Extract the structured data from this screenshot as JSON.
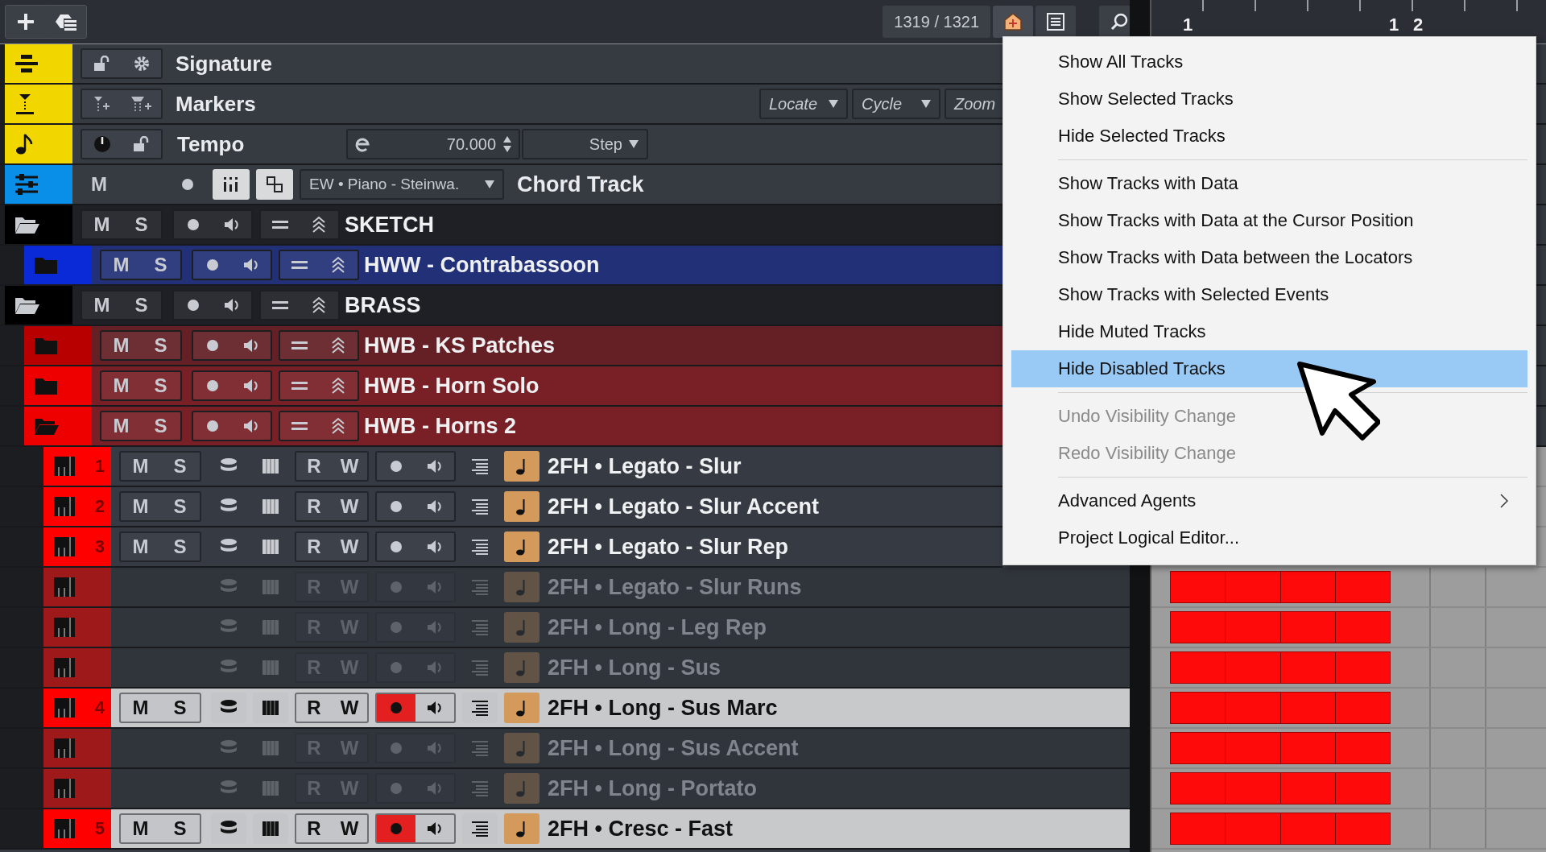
{
  "toolbar": {
    "counter": "1319 / 1321"
  },
  "ruler": {
    "labels": [
      "1",
      "1",
      "2"
    ]
  },
  "tracks": [
    {
      "kind": "signature",
      "name": "Signature",
      "color": "#f2d600"
    },
    {
      "kind": "markers",
      "name": "Markers",
      "color": "#f2d600",
      "dropdowns": [
        {
          "label": "Locate",
          "caret": true
        },
        {
          "label": "Cycle",
          "caret": true
        },
        {
          "label": "Zoom",
          "caret": false
        }
      ]
    },
    {
      "kind": "tempo",
      "name": "Tempo",
      "color": "#f2d600",
      "on": true,
      "value": "70.000",
      "mode": "Step"
    },
    {
      "kind": "chord",
      "name": "Chord Track",
      "color": "#0a8fe8",
      "mute": "M",
      "instrument": "EW • Piano - Steinwa.",
      "editor_on": true,
      "voicing_on": true
    },
    {
      "kind": "folder",
      "name": "SKETCH",
      "color": "#000000",
      "mute": "M",
      "solo": "S",
      "expanded": true,
      "children": [
        {
          "kind": "folder",
          "name": "HWW - Contrabassoon",
          "color": "#0a2ad8",
          "mute": "M",
          "solo": "S",
          "expanded": false
        }
      ]
    },
    {
      "kind": "folder",
      "name": "BRASS",
      "color": "#000000",
      "mute": "M",
      "solo": "S",
      "expanded": true,
      "children": [
        {
          "kind": "folder",
          "name": "HWB - KS Patches",
          "color": "#b80000",
          "mute": "M",
          "solo": "S",
          "expanded": false
        },
        {
          "kind": "folder",
          "name": "HWB - Horn Solo",
          "color": "#ee0000",
          "mute": "M",
          "solo": "S",
          "expanded": false
        },
        {
          "kind": "folder",
          "name": "HWB - Horns 2",
          "color": "#ee0000",
          "mute": "M",
          "solo": "S",
          "expanded": true,
          "children": [
            {
              "kind": "midi",
              "number": "1",
              "name": "2FH • Legato - Slur",
              "color": "#ff0000",
              "mute": "M",
              "solo": "S",
              "read": "R",
              "write": "W",
              "enabled": true,
              "selected": false,
              "record": false
            },
            {
              "kind": "midi",
              "number": "2",
              "name": "2FH • Legato - Slur Accent",
              "color": "#ff0000",
              "mute": "M",
              "solo": "S",
              "read": "R",
              "write": "W",
              "enabled": true,
              "selected": false,
              "record": false
            },
            {
              "kind": "midi",
              "number": "3",
              "name": "2FH • Legato - Slur Rep",
              "color": "#ff0000",
              "mute": "M",
              "solo": "S",
              "read": "R",
              "write": "W",
              "enabled": true,
              "selected": false,
              "record": false
            },
            {
              "kind": "midi",
              "name": "2FH • Legato - Slur Runs",
              "color": "#9e1a1a",
              "read": "R",
              "write": "W",
              "enabled": false,
              "selected": false,
              "record": false
            },
            {
              "kind": "midi",
              "name": "2FH • Long - Leg Rep",
              "color": "#9e1a1a",
              "read": "R",
              "write": "W",
              "enabled": false,
              "selected": false,
              "record": false
            },
            {
              "kind": "midi",
              "name": "2FH • Long - Sus",
              "color": "#9e1a1a",
              "read": "R",
              "write": "W",
              "enabled": false,
              "selected": false,
              "record": false
            },
            {
              "kind": "midi",
              "number": "4",
              "name": "2FH • Long - Sus Marc",
              "color": "#ff0000",
              "mute": "M",
              "solo": "S",
              "read": "R",
              "write": "W",
              "enabled": true,
              "selected": true,
              "record": true
            },
            {
              "kind": "midi",
              "name": "2FH • Long - Sus Accent",
              "color": "#9e1a1a",
              "read": "R",
              "write": "W",
              "enabled": false,
              "selected": false,
              "record": false
            },
            {
              "kind": "midi",
              "name": "2FH • Long - Portato",
              "color": "#9e1a1a",
              "read": "R",
              "write": "W",
              "enabled": false,
              "selected": false,
              "record": false
            },
            {
              "kind": "midi",
              "number": "5",
              "name": "2FH • Cresc - Fast",
              "color": "#ff0000",
              "mute": "M",
              "solo": "S",
              "read": "R",
              "write": "W",
              "enabled": true,
              "selected": true,
              "record": true
            }
          ]
        }
      ]
    }
  ],
  "menu": [
    {
      "kind": "item",
      "label": "Show All Tracks",
      "selected": false,
      "disabled": false,
      "submenu": false
    },
    {
      "kind": "item",
      "label": "Show Selected Tracks",
      "selected": false,
      "disabled": false,
      "submenu": false
    },
    {
      "kind": "item",
      "label": "Hide Selected Tracks",
      "selected": false,
      "disabled": false,
      "submenu": false
    },
    {
      "kind": "separator"
    },
    {
      "kind": "item",
      "label": "Show Tracks with Data",
      "selected": false,
      "disabled": false,
      "submenu": false
    },
    {
      "kind": "item",
      "label": "Show Tracks with Data at the Cursor Position",
      "selected": false,
      "disabled": false,
      "submenu": false
    },
    {
      "kind": "item",
      "label": "Show Tracks with Data between the Locators",
      "selected": false,
      "disabled": false,
      "submenu": false
    },
    {
      "kind": "item",
      "label": "Show Tracks with Selected Events",
      "selected": false,
      "disabled": false,
      "submenu": false
    },
    {
      "kind": "item",
      "label": "Hide Muted Tracks",
      "selected": false,
      "disabled": false,
      "submenu": false
    },
    {
      "kind": "item",
      "label": "Hide Disabled Tracks",
      "selected": true,
      "disabled": false,
      "submenu": false
    },
    {
      "kind": "separator"
    },
    {
      "kind": "item",
      "label": "Undo Visibility Change",
      "selected": false,
      "disabled": true,
      "submenu": false
    },
    {
      "kind": "item",
      "label": "Redo Visibility Change",
      "selected": false,
      "disabled": true,
      "submenu": false
    },
    {
      "kind": "separator"
    },
    {
      "kind": "item",
      "label": "Advanced Agents",
      "selected": false,
      "disabled": false,
      "submenu": true
    },
    {
      "kind": "item",
      "label": "Project Logical Editor...",
      "selected": false,
      "disabled": false,
      "submenu": false
    }
  ]
}
